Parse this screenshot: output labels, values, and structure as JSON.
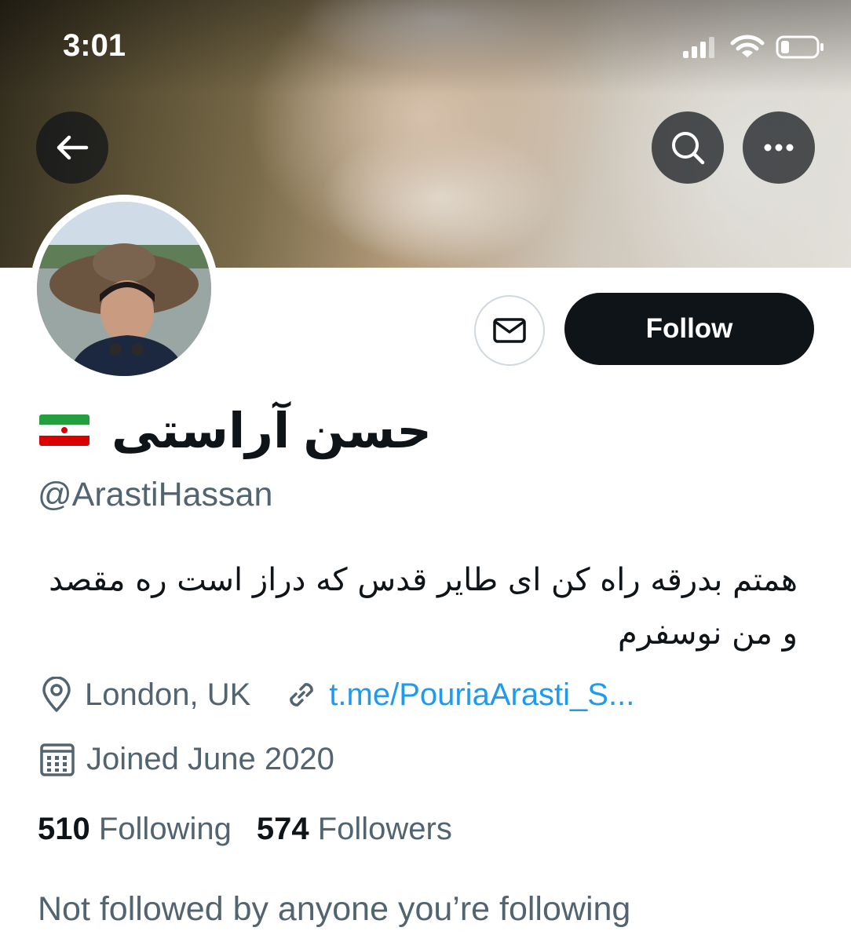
{
  "status_bar": {
    "time": "3:01"
  },
  "header": {
    "back_icon": "arrow-left-icon",
    "search_icon": "search-icon",
    "more_icon": "more-horizontal-icon"
  },
  "profile": {
    "display_name": "حسن آراستی",
    "flag": "iran-flag",
    "handle": "@ArastiHassan",
    "bio": "همتم بدرقه راه کن ای طایر قدس که دراز است ره مقصد و من نوسفرم",
    "location": "London, UK",
    "link": "t.me/PouriaArasti_S...",
    "joined": "Joined June 2020",
    "following_count": "510",
    "following_label": "Following",
    "followers_count": "574",
    "followers_label": "Followers",
    "mutuals_text": "Not followed by anyone you’re following"
  },
  "actions": {
    "follow_label": "Follow",
    "message_icon": "envelope-icon"
  },
  "colors": {
    "accent": "#1d9bf0",
    "text_primary": "#0f1419",
    "text_secondary": "#536471",
    "button_dark": "#0f1419"
  }
}
